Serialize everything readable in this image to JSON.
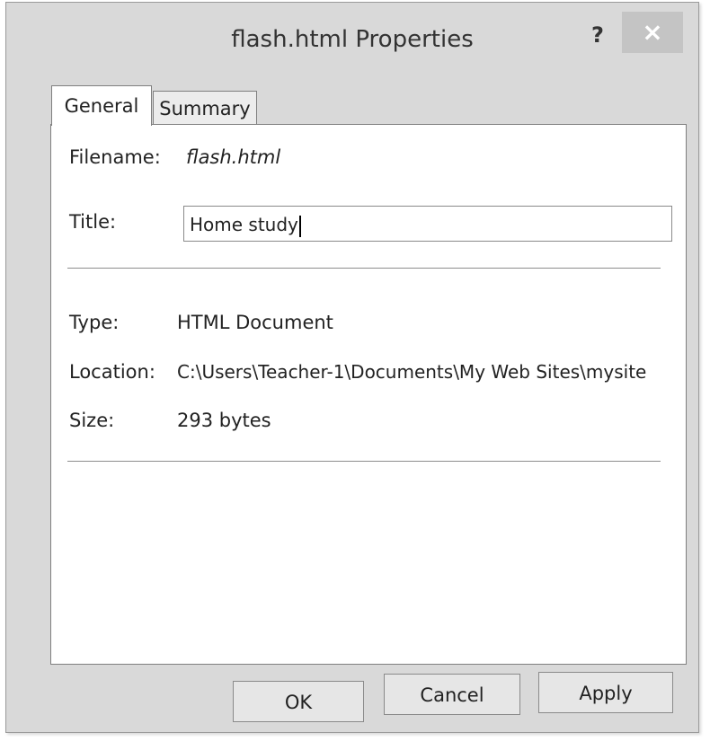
{
  "window": {
    "title": "flash.html Properties",
    "help_label": "?",
    "close_label": "×"
  },
  "tabs": [
    {
      "label": "General",
      "active": true
    },
    {
      "label": "Summary",
      "active": false
    }
  ],
  "general": {
    "filename_label": "Filename:",
    "filename_value": "flash.html",
    "title_label": "Title:",
    "title_value": "Home study",
    "type_label": "Type:",
    "type_value": "HTML Document",
    "location_label": "Location:",
    "location_value": "C:\\Users\\Teacher-1\\Documents\\My Web Sites\\mysite",
    "size_label": "Size:",
    "size_value": "293 bytes"
  },
  "buttons": {
    "ok": "OK",
    "cancel": "Cancel",
    "apply": "Apply"
  }
}
